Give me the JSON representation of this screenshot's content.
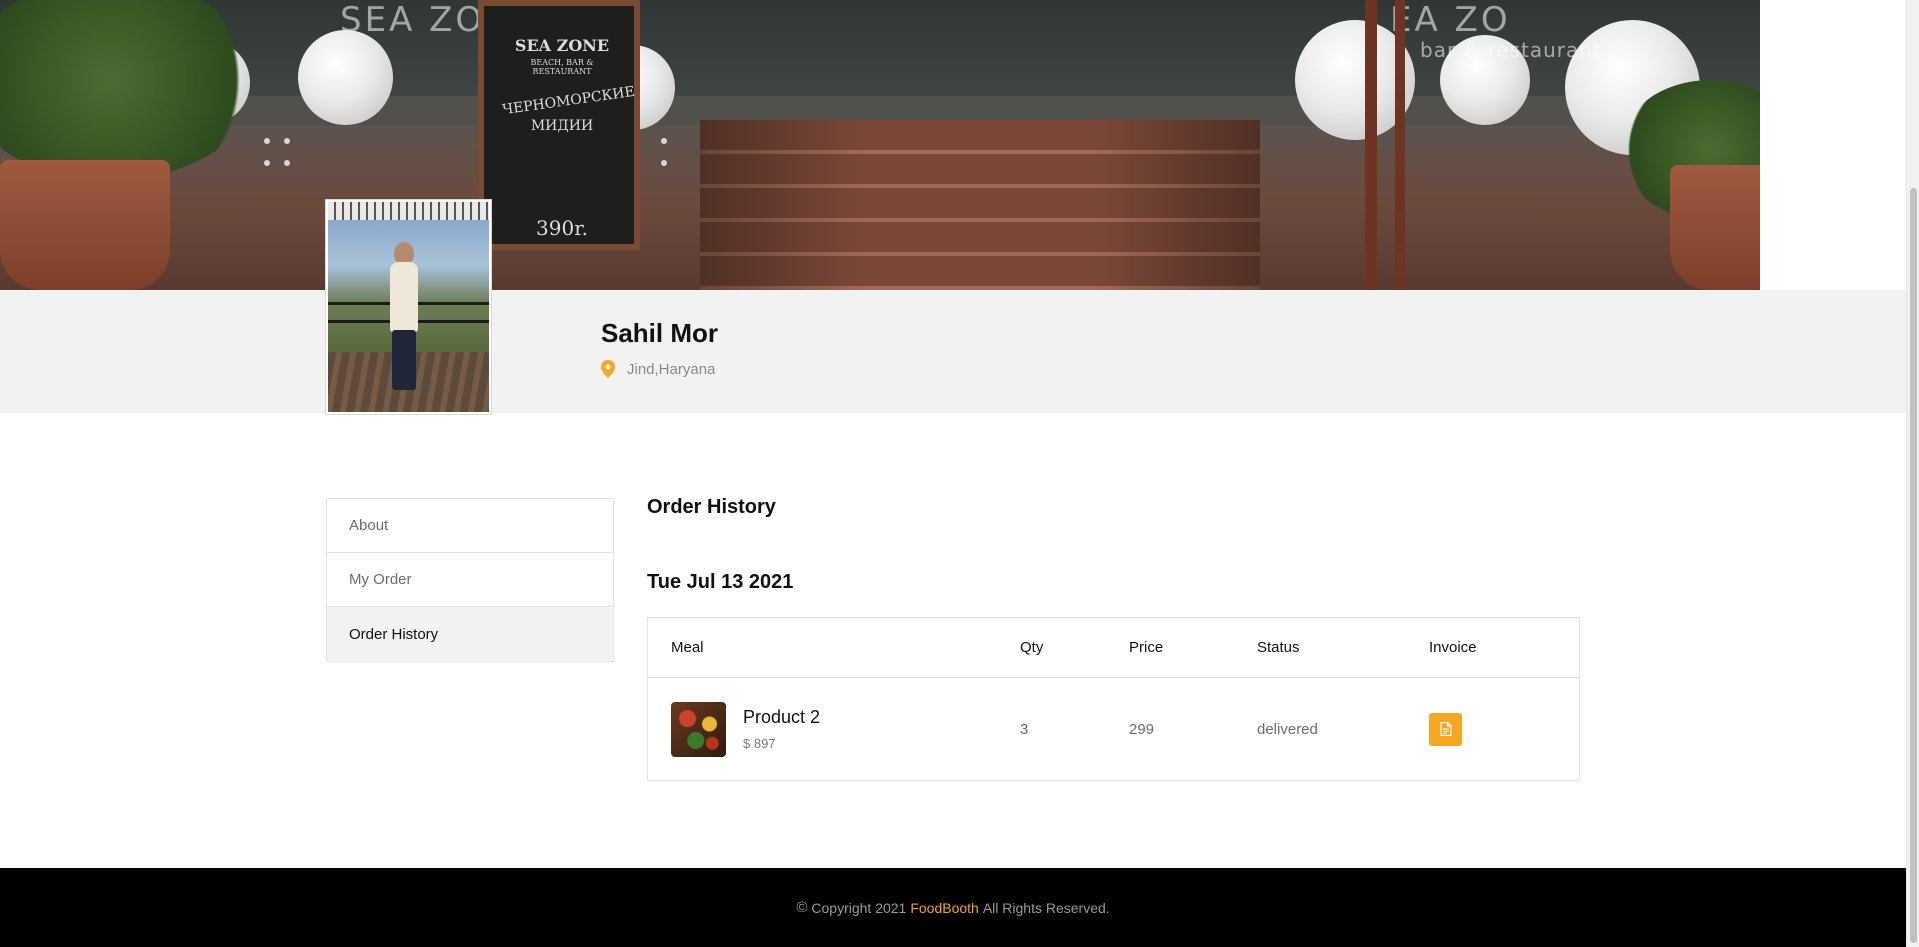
{
  "profile": {
    "name": "Sahil Mor",
    "location": "Jind,Haryana"
  },
  "banner": {
    "sign_words_left": "SEA ZO",
    "sign_words_right": "EA ZO",
    "sign_sub": "bar & restaurant",
    "board_title": "SEA ZONE",
    "board_sub": "BEACH, BAR & RESTAURANT",
    "board_line1": "ЧЕРНОМОРСКИЕ",
    "board_line2": "МИДИИ",
    "board_price": "390r."
  },
  "sidebar": {
    "items": [
      {
        "label": "About"
      },
      {
        "label": "My Order"
      },
      {
        "label": "Order History"
      }
    ]
  },
  "main": {
    "title": "Order History",
    "date": "Tue Jul 13 2021",
    "table": {
      "headers": [
        "Meal",
        "Qty",
        "Price",
        "Status",
        "Invoice"
      ],
      "rows": [
        {
          "meal": "Product 2",
          "meal_total": "$ 897",
          "qty": "3",
          "price": "299",
          "status": "delivered"
        }
      ]
    }
  },
  "footer": {
    "copyright": "Copyright 2021",
    "brand": "FoodBooth",
    "rights": "All Rights Reserved."
  },
  "colors": {
    "accent": "#f5a623",
    "strip": "#f2f2f2",
    "footer": "#000000"
  },
  "icons": [
    "location-pin-icon",
    "document-icon",
    "copyright-icon"
  ]
}
